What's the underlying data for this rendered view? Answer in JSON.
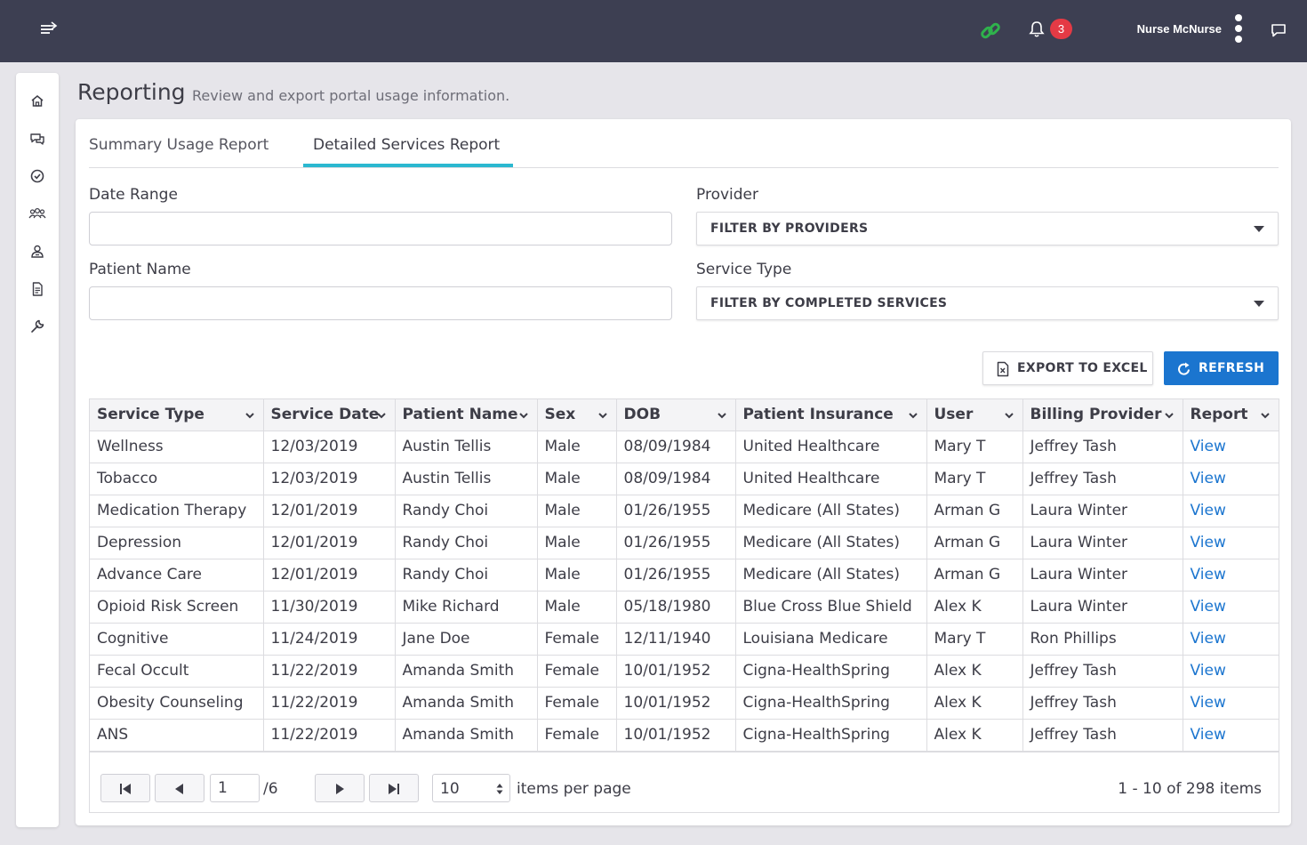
{
  "topbar": {
    "notification_count": "3",
    "user_name": "Nurse McNurse",
    "icons": [
      "menu-toggle-icon",
      "link-icon",
      "bell-icon",
      "kebab-menu-icon",
      "chat-icon"
    ],
    "link_icon_color": "#2fb24c",
    "badge_color": "#e43a45"
  },
  "sidebar": {
    "items": [
      "home-icon",
      "messages-icon",
      "check-circle-icon",
      "group-icon",
      "user-badge-icon",
      "document-icon",
      "wrench-icon"
    ]
  },
  "header": {
    "title": "Reporting",
    "subtitle": "Review and export portal usage information."
  },
  "tabs": [
    {
      "label": "Summary Usage Report",
      "active": false
    },
    {
      "label": "Detailed Services Report",
      "active": true
    }
  ],
  "filters": {
    "date_range_label": "Date Range",
    "date_range_value": "",
    "patient_name_label": "Patient Name",
    "patient_name_value": "",
    "provider_label": "Provider",
    "provider_value": "FILTER BY PROVIDERS",
    "service_type_label": "Service Type",
    "service_type_value": "FILTER BY COMPLETED SERVICES"
  },
  "actions": {
    "export_label": "EXPORT TO EXCEL",
    "refresh_label": "REFRESH",
    "accent_color": "#1b75cf"
  },
  "table": {
    "columns": [
      "Service Type",
      "Service Date",
      "Patient Name",
      "Sex",
      "DOB",
      "Patient Insurance",
      "User",
      "Billing Provider",
      "Report"
    ],
    "rows": [
      [
        "Wellness",
        "12/03/2019",
        "Austin Tellis",
        "Male",
        "08/09/1984",
        "United Healthcare",
        "Mary T",
        "Jeffrey Tash",
        "View"
      ],
      [
        "Tobacco",
        "12/03/2019",
        "Austin Tellis",
        "Male",
        "08/09/1984",
        "United Healthcare",
        "Mary T",
        "Jeffrey Tash",
        "View"
      ],
      [
        "Medication Therapy",
        "12/01/2019",
        "Randy Choi",
        "Male",
        "01/26/1955",
        "Medicare (All States)",
        "Arman G",
        "Laura Winter",
        "View"
      ],
      [
        "Depression",
        "12/01/2019",
        "Randy Choi",
        "Male",
        "01/26/1955",
        "Medicare (All States)",
        "Arman G",
        "Laura Winter",
        "View"
      ],
      [
        "Advance Care",
        "12/01/2019",
        "Randy Choi",
        "Male",
        "01/26/1955",
        "Medicare (All States)",
        "Arman G",
        "Laura Winter",
        "View"
      ],
      [
        "Opioid Risk Screen",
        "11/30/2019",
        "Mike Richard",
        "Male",
        "05/18/1980",
        "Blue Cross Blue Shield",
        "Alex K",
        "Laura Winter",
        "View"
      ],
      [
        "Cognitive",
        "11/24/2019",
        "Jane Doe",
        "Female",
        "12/11/1940",
        "Louisiana Medicare",
        "Mary T",
        "Ron Phillips",
        "View"
      ],
      [
        "Fecal Occult",
        "11/22/2019",
        "Amanda Smith",
        "Female",
        "10/01/1952",
        "Cigna-HealthSpring",
        "Alex K",
        "Jeffrey Tash",
        "View"
      ],
      [
        "Obesity Counseling",
        "11/22/2019",
        "Amanda Smith",
        "Female",
        "10/01/1952",
        "Cigna-HealthSpring",
        "Alex K",
        "Jeffrey Tash",
        "View"
      ],
      [
        "ANS",
        "11/22/2019",
        "Amanda Smith",
        "Female",
        "10/01/1952",
        "Cigna-HealthSpring",
        "Alex K",
        "Jeffrey Tash",
        "View"
      ]
    ]
  },
  "pager": {
    "current_page": "1",
    "total_pages": "/6",
    "per_page": "10",
    "per_page_label": "items per page",
    "info": "1 - 10 of 298 items"
  }
}
